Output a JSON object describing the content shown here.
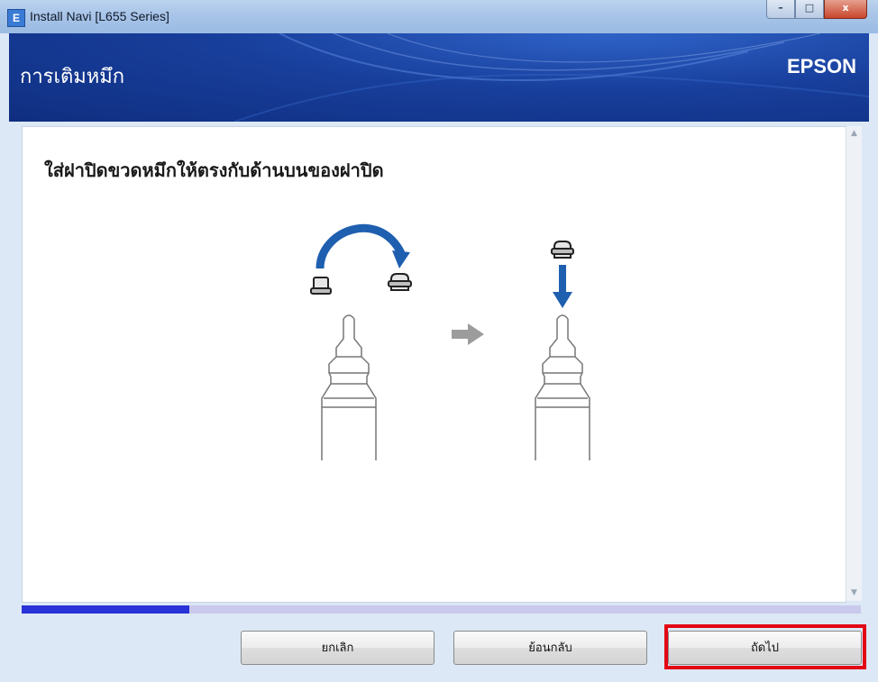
{
  "window": {
    "title": "Install Navi [L655 Series]",
    "app_icon_letter": "E",
    "minimize_label": "–",
    "maximize_label": "□",
    "close_label": "x"
  },
  "header": {
    "title": "การเติมหมึก",
    "brand": "EPSON"
  },
  "content": {
    "instruction": "ใส่ฝาปิดขวดหมึกให้ตรงกับด้านบนของฝาปิด",
    "illustration": [
      "bottle-cap-flip-illustration",
      "bottle-cap-attach-illustration"
    ]
  },
  "progress": {
    "fraction": 0.2
  },
  "buttons": {
    "cancel": "ยกเลิก",
    "back": "ย้อนกลับ",
    "next": "ถัดไป"
  },
  "colors": {
    "header_blue": "#183f9c",
    "progress_fill": "#2a33d8",
    "progress_track": "#c9c9ec",
    "highlight_red": "#e30613",
    "illustration_blue": "#1f5fb0"
  }
}
